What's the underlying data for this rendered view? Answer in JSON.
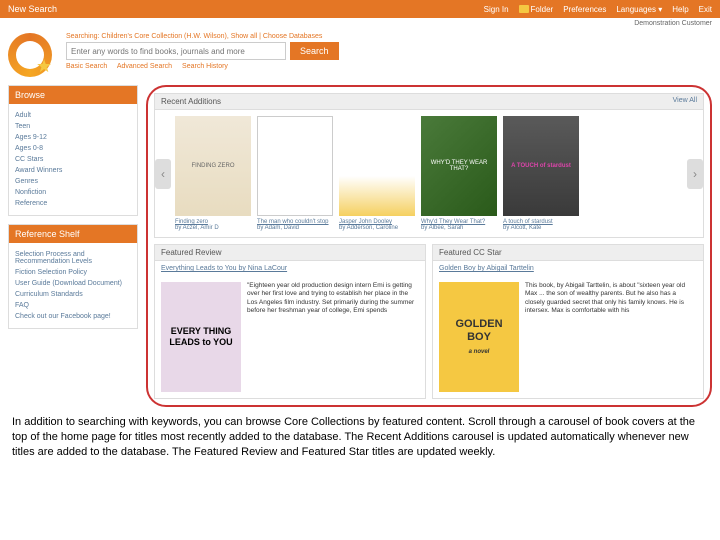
{
  "topbar": {
    "newSearch": "New Search",
    "signIn": "Sign In",
    "folder": "Folder",
    "preferences": "Preferences",
    "languages": "Languages",
    "help": "Help",
    "exit": "Exit"
  },
  "demo": "Demonstration Customer",
  "search": {
    "meta": "Searching: Children's Core Collection (H.W. Wilson), Show all | Choose Databases",
    "placeholder": "Enter any words to find books, journals and more",
    "button": "Search",
    "links": {
      "basic": "Basic Search",
      "advanced": "Advanced Search",
      "history": "Search History"
    }
  },
  "browse": {
    "title": "Browse",
    "items": [
      "Adult",
      "Teen",
      "Ages 9-12",
      "Ages 0-8",
      "CC Stars",
      "Award Winners",
      "Genres",
      "Nonfiction",
      "Reference"
    ]
  },
  "refshelf": {
    "title": "Reference Shelf",
    "items": [
      "Selection Process and Recommendation Levels",
      "Fiction Selection Policy",
      "User Guide (Download Document)",
      "Curriculum Standards",
      "FAQ",
      "Check out our Facebook page!"
    ]
  },
  "recent": {
    "title": "Recent Additions",
    "viewAll": "View All",
    "books": [
      {
        "cover": "FINDING ZERO",
        "title": "Finding zero",
        "author": "by Aczel, Amir D"
      },
      {
        "cover": "",
        "title": "The man who couldn't stop",
        "author": "by Adam, David"
      },
      {
        "cover": "",
        "title": "Jasper John Dooley",
        "author": "by Adderson, Caroline"
      },
      {
        "cover": "WHY'D THEY WEAR THAT?",
        "title": "Why'd They Wear That?",
        "author": "by Albee, Sarah"
      },
      {
        "cover": "A TOUCH of stardust",
        "title": "A touch of stardust",
        "author": "by Alcott, Kate"
      }
    ]
  },
  "featReview": {
    "head": "Featured Review",
    "title": "Everything Leads to You by Nina LaCour",
    "cover": "EVERY THING LEADS to YOU",
    "text": "\"Eighteen year old production design intern Emi is getting over her first love and trying to establish her place in the Los Angeles film industry. Set primarily during the summer before her freshman year of college, Emi spends"
  },
  "featStar": {
    "head": "Featured CC Star",
    "title": "Golden Boy by Abigail Tarttelin",
    "cover": "GOLDEN BOY",
    "coverSub": "a novel",
    "text": "This book, by Abigail Tarttelin, is about \"sixteen year old Max ... the son of wealthy parents. But he also has a closely guarded secret that only his family knows. He is intersex. Max is comfortable with his"
  },
  "caption": "In addition to searching with keywords, you can browse Core Collections by featured content. Scroll through a carousel of book covers at the top of the home page for titles most recently added to the database. The Recent Additions carousel is updated automatically whenever new titles are added to the database. The Featured Review and Featured Star titles are updated weekly."
}
